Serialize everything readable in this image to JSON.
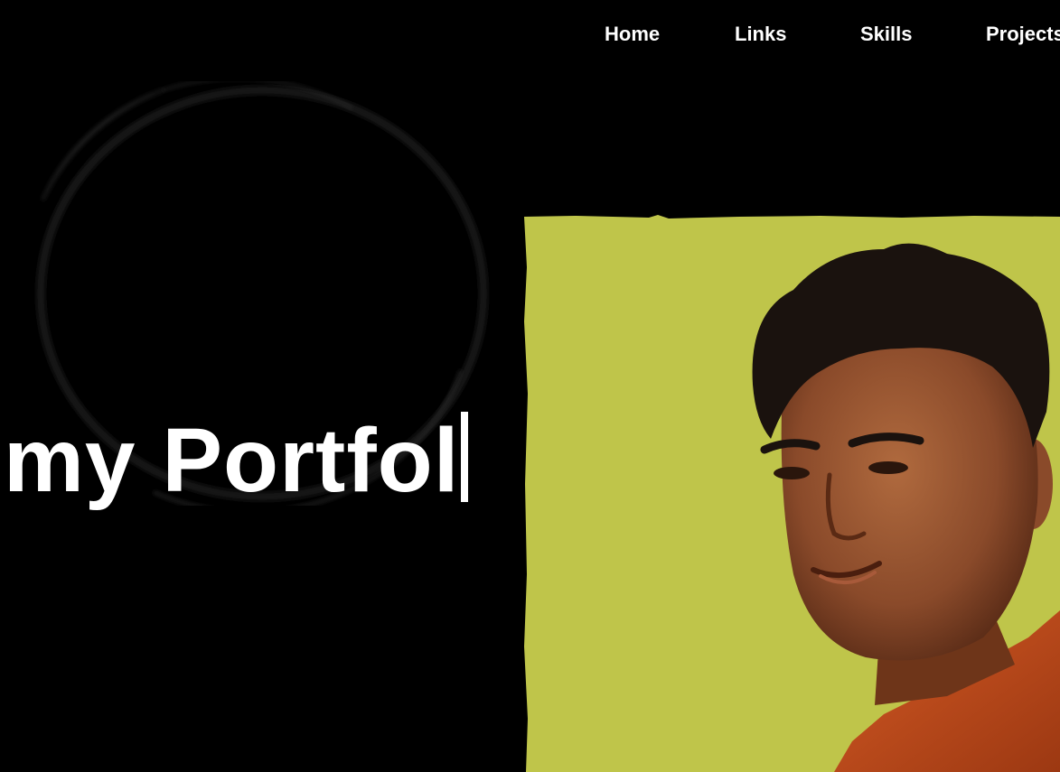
{
  "nav": {
    "items": [
      {
        "label": "Home"
      },
      {
        "label": "Links"
      },
      {
        "label": "Skills"
      },
      {
        "label": "Projects"
      }
    ]
  },
  "hero": {
    "heading": "my Portfol"
  },
  "photo": {
    "icon": "profile-photo",
    "background_color": "#bfc54a",
    "shirt_color": "#c2481a",
    "skin_color": "#8a4a2a",
    "hair_color": "#1a120e"
  },
  "colors": {
    "page_background": "#000000",
    "text": "#ffffff"
  }
}
